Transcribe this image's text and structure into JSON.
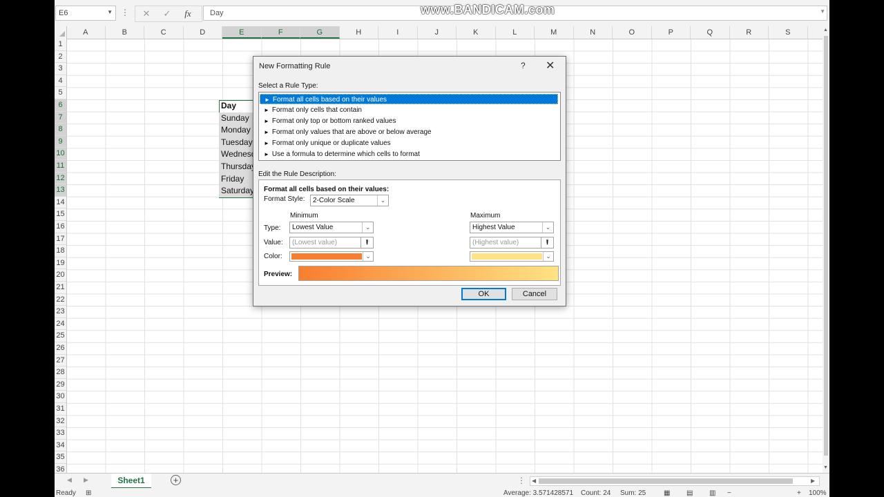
{
  "formula_bar": {
    "name_box": "E6",
    "cancel_icon": "✕",
    "enter_icon": "✓",
    "fx_label": "fx",
    "content": "Day",
    "watermark": "www.BANDICAM.com"
  },
  "columns": [
    "A",
    "B",
    "C",
    "D",
    "E",
    "F",
    "G",
    "H",
    "I",
    "J",
    "K",
    "L",
    "M",
    "N",
    "O",
    "P",
    "Q",
    "R",
    "S"
  ],
  "rows": [
    "1",
    "2",
    "3",
    "4",
    "5",
    "6",
    "7",
    "8",
    "9",
    "10",
    "11",
    "12",
    "13",
    "14",
    "15",
    "16",
    "17",
    "18",
    "19",
    "20",
    "21",
    "22",
    "23",
    "24",
    "25",
    "26",
    "27",
    "28",
    "29",
    "30",
    "31",
    "32",
    "33",
    "34",
    "35",
    "36"
  ],
  "cells": {
    "header": "Day",
    "days": [
      "Sunday",
      "Monday",
      "Tuesday",
      "Wednesday",
      "Thursday",
      "Friday",
      "Saturday"
    ]
  },
  "sheet_tabs": {
    "active": "Sheet1",
    "add": "+"
  },
  "status_bar": {
    "mode": "Ready",
    "average": "Average: 3.571428571",
    "count": "Count: 24",
    "sum": "Sum: 25",
    "zoom": "100%"
  },
  "dialog": {
    "title": "New Formatting Rule",
    "help": "?",
    "close": "✕",
    "rule_type_label": "Select a Rule Type:",
    "rule_types": [
      "Format all cells based on their values",
      "Format only cells that contain",
      "Format only top or bottom ranked values",
      "Format only values that are above or below average",
      "Format only unique or duplicate values",
      "Use a formula to determine which cells to format"
    ],
    "edit_label": "Edit the Rule Description:",
    "format_all_label": "Format all cells based on their values:",
    "format_style_label": "Format Style:",
    "format_style_value": "2-Color Scale",
    "minimum_label": "Minimum",
    "maximum_label": "Maximum",
    "type_label": "Type:",
    "value_label": "Value:",
    "color_label": "Color:",
    "min_type": "Lowest Value",
    "max_type": "Highest Value",
    "min_value_placeholder": "(Lowest value)",
    "max_value_placeholder": "(Highest value)",
    "min_color": "#f87e2f",
    "max_color": "#ffe384",
    "preview_label": "Preview:",
    "ok": "OK",
    "cancel": "Cancel"
  },
  "colors": {
    "accent": "#217346",
    "selection": "#0078d7"
  }
}
